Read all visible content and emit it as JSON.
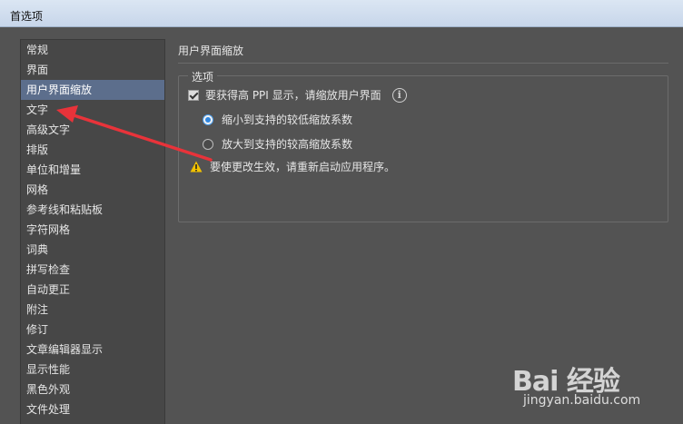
{
  "window": {
    "title": "首选项"
  },
  "sidebar": {
    "items": [
      {
        "label": "常规"
      },
      {
        "label": "界面"
      },
      {
        "label": "用户界面缩放",
        "active": true
      },
      {
        "label": "文字"
      },
      {
        "label": "高级文字"
      },
      {
        "label": "排版"
      },
      {
        "label": "单位和增量"
      },
      {
        "label": "网格"
      },
      {
        "label": "参考线和粘贴板"
      },
      {
        "label": "字符网格"
      },
      {
        "label": "词典"
      },
      {
        "label": "拼写检查"
      },
      {
        "label": "自动更正"
      },
      {
        "label": "附注"
      },
      {
        "label": "修订"
      },
      {
        "label": "文章编辑器显示"
      },
      {
        "label": "显示性能"
      },
      {
        "label": "黑色外观"
      },
      {
        "label": "文件处理"
      }
    ]
  },
  "main": {
    "section_title": "用户界面缩放",
    "options": {
      "legend": "选项",
      "hi_ppi_checkbox": {
        "label": "要获得高 PPI 显示，请缩放用户界面",
        "checked": true
      },
      "radio_shrink": {
        "label": "缩小到支持的较低缩放系数",
        "selected": true
      },
      "radio_enlarge": {
        "label": "放大到支持的较高缩放系数",
        "selected": false
      },
      "warning": "要使更改生效，请重新启动应用程序。"
    }
  },
  "watermark": {
    "logo": "Bai 经验",
    "url": "jingyan.baidu.com"
  },
  "colors": {
    "accent": "#5c6e8c",
    "radio_on": "#2f86e0",
    "arrow": "#e8333a",
    "warning": "#f2c200"
  }
}
